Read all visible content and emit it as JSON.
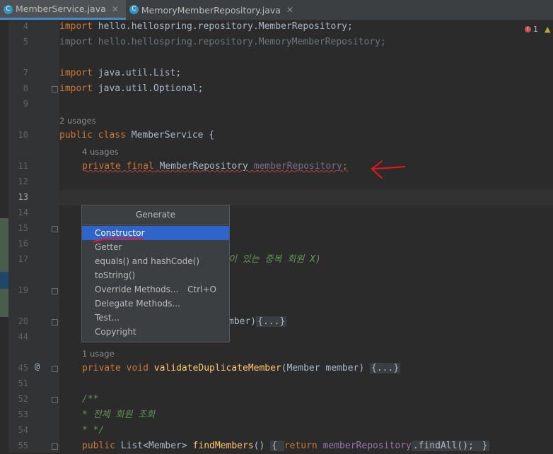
{
  "tabs": [
    {
      "label": "MemberService.java",
      "icon": "c-class-icon",
      "active": true
    },
    {
      "label": "MemoryMemberRepository.java",
      "icon": "c-class-icon",
      "active": false
    }
  ],
  "inspection": {
    "error_count": "1"
  },
  "editor": {
    "line_numbers": [
      "4",
      "5",
      "7",
      "8",
      "9",
      "10",
      "11",
      "12",
      "13",
      "14",
      "15",
      "16",
      "17",
      "19",
      "20",
      "44",
      "45",
      "51",
      "52",
      "53",
      "54",
      "55"
    ],
    "l4": {
      "kw": "import",
      "rest": " hello.hellospring.repository.MemberRepository;"
    },
    "l5": {
      "text": "import hello.hellospring.repository.MemoryMemberRepository;"
    },
    "l7": {
      "kw": "import",
      "rest": " java.util.List;"
    },
    "l8": {
      "kw": "import",
      "rest": " java.util.Optional;"
    },
    "usages_class": "2 usages",
    "l10": {
      "kw1": "public",
      "kw2": "class",
      "rest": " MemberService {"
    },
    "usages_field": "4 usages",
    "l11": {
      "kw1": "private",
      "kw2": "final",
      "type": " MemberRepository ",
      "field": "memberRepository",
      "end": ";"
    },
    "l17_tail": "이 있는 중복 회원 X)",
    "l20_tail": "mber)",
    "collapsed": "{...}",
    "usages_method": "1 usage",
    "gutter_at": "@",
    "l45": {
      "kw1": "private",
      "kw2": "void",
      "fn": "validateDuplicateMember",
      "params": "(Member member) "
    },
    "l52": "/**",
    "l53": "* 전체 회원 조회",
    "l54": "* */",
    "l55": {
      "kw": "public",
      "type": " List<Member> ",
      "fn": "findMembers",
      "p": "() ",
      "lb": "{ ",
      "ret": "return",
      "field": "memberRepository",
      "call": ".findAll(); ",
      "rb": "}"
    }
  },
  "generate_popup": {
    "title": "Generate",
    "items": [
      {
        "label": "Constructor",
        "selected": true,
        "shortcut": ""
      },
      {
        "label": "Getter",
        "selected": false,
        "shortcut": ""
      },
      {
        "label": "equals() and hashCode()",
        "selected": false,
        "shortcut": ""
      },
      {
        "label": "toString()",
        "selected": false,
        "shortcut": ""
      },
      {
        "label": "Override Methods...",
        "selected": false,
        "shortcut": "Ctrl+O"
      },
      {
        "label": "Delegate Methods...",
        "selected": false,
        "shortcut": ""
      },
      {
        "label": "Test...",
        "selected": false,
        "shortcut": ""
      },
      {
        "label": "Copyright",
        "selected": false,
        "shortcut": ""
      }
    ]
  },
  "colors": {
    "accent": "#4a88c7",
    "selection": "#2f65ca",
    "annotation": "#e8161c"
  }
}
